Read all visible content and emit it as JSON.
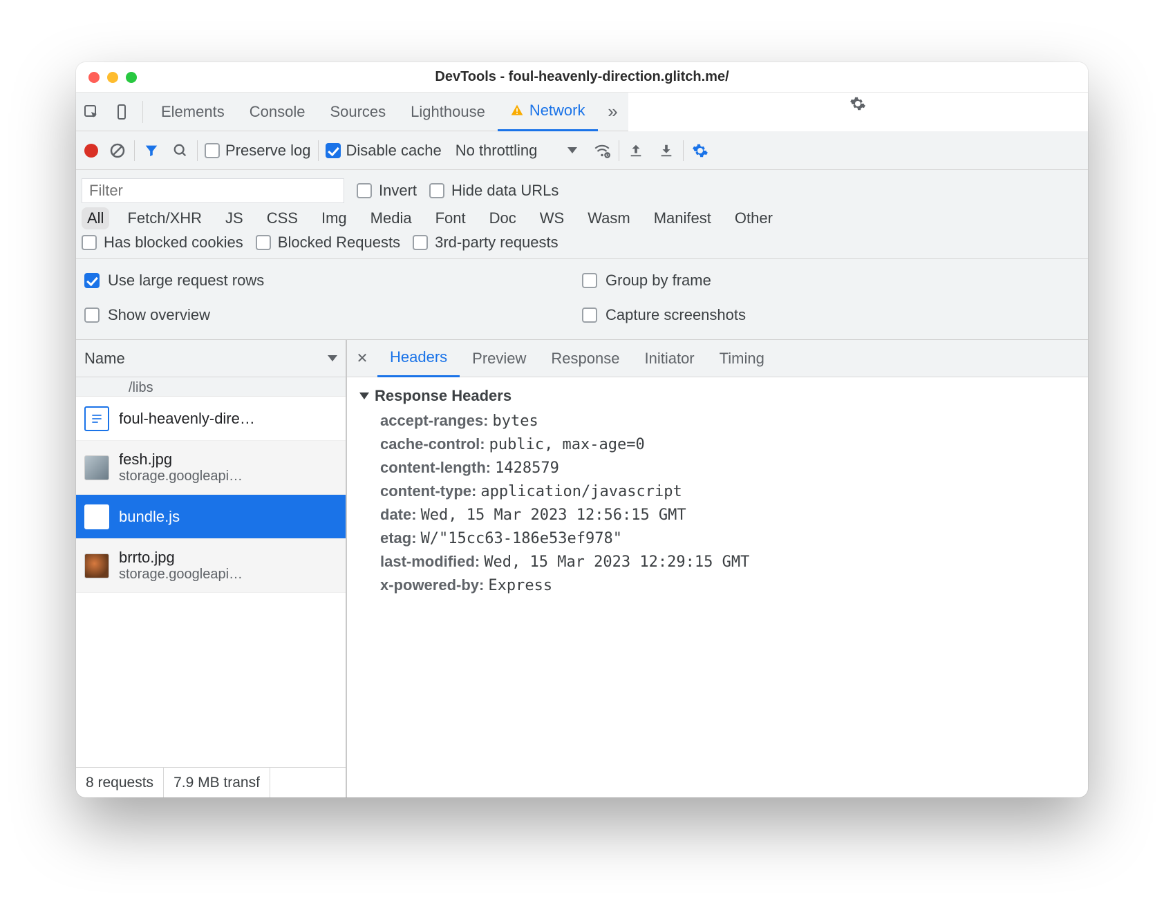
{
  "window": {
    "title": "DevTools - foul-heavenly-direction.glitch.me/"
  },
  "tabs": {
    "items": [
      "Elements",
      "Console",
      "Sources",
      "Lighthouse",
      "Network"
    ],
    "active": "Network",
    "warning_on": "Network"
  },
  "toolbar": {
    "preserve_log": "Preserve log",
    "disable_cache": "Disable cache",
    "throttling": "No throttling"
  },
  "filter": {
    "placeholder": "Filter",
    "invert": "Invert",
    "hide_data_urls": "Hide data URLs",
    "types": [
      "All",
      "Fetch/XHR",
      "JS",
      "CSS",
      "Img",
      "Media",
      "Font",
      "Doc",
      "WS",
      "Wasm",
      "Manifest",
      "Other"
    ],
    "active_type": "All",
    "has_blocked_cookies": "Has blocked cookies",
    "blocked_requests": "Blocked Requests",
    "third_party": "3rd-party requests"
  },
  "settings": {
    "large_rows": "Use large request rows",
    "group_by_frame": "Group by frame",
    "show_overview": "Show overview",
    "capture_screenshots": "Capture screenshots"
  },
  "request_list": {
    "column": "Name",
    "peek": "/libs",
    "rows": [
      {
        "name": "foul-heavenly-dire…",
        "sub": "",
        "kind": "doc"
      },
      {
        "name": "fesh.jpg",
        "sub": "storage.googleapi…",
        "kind": "img1"
      },
      {
        "name": "bundle.js",
        "sub": "",
        "kind": "js",
        "selected": true
      },
      {
        "name": "brrto.jpg",
        "sub": "storage.googleapi…",
        "kind": "img2"
      }
    ]
  },
  "footer": {
    "requests": "8 requests",
    "transferred": "7.9 MB transf"
  },
  "detail_tabs": [
    "Headers",
    "Preview",
    "Response",
    "Initiator",
    "Timing"
  ],
  "detail_active": "Headers",
  "response_headers": {
    "section": "Response Headers",
    "items": [
      {
        "k": "accept-ranges:",
        "v": "bytes"
      },
      {
        "k": "cache-control:",
        "v": "public, max-age=0"
      },
      {
        "k": "content-length:",
        "v": "1428579"
      },
      {
        "k": "content-type:",
        "v": "application/javascript"
      },
      {
        "k": "date:",
        "v": "Wed, 15 Mar 2023 12:56:15 GMT"
      },
      {
        "k": "etag:",
        "v": "W/\"15cc63-186e53ef978\""
      },
      {
        "k": "last-modified:",
        "v": "Wed, 15 Mar 2023 12:29:15 GMT"
      },
      {
        "k": "x-powered-by:",
        "v": "Express"
      }
    ]
  }
}
